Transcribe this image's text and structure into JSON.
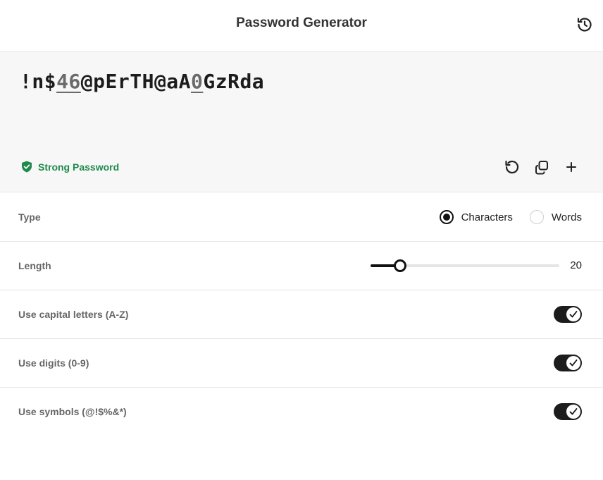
{
  "header": {
    "title": "Password Generator",
    "history_icon": "history-icon"
  },
  "password": {
    "segments": [
      {
        "text": "!n$",
        "digit": false
      },
      {
        "text": "46",
        "digit": true
      },
      {
        "text": "@pErTH@aA",
        "digit": false
      },
      {
        "text": "0",
        "digit": true
      },
      {
        "text": "GzRda",
        "digit": false
      }
    ],
    "strength_label": "Strong Password"
  },
  "actions": {
    "regenerate_icon": "refresh-icon",
    "copy_icon": "copy-icon",
    "add_icon": "plus-icon"
  },
  "settings": {
    "type": {
      "label": "Type",
      "options": [
        "Characters",
        "Words"
      ],
      "selected": "Characters"
    },
    "length": {
      "label": "Length",
      "value": "20",
      "min": 5,
      "max": 100
    },
    "capitals": {
      "label": "Use capital letters (A-Z)",
      "on": true
    },
    "digits": {
      "label": "Use digits (0-9)",
      "on": true
    },
    "symbols": {
      "label": "Use symbols (@!$%&*)",
      "on": true
    }
  },
  "colors": {
    "accent": "#111111",
    "strong": "#1f8a4c",
    "panel": "#f7f7f7"
  }
}
